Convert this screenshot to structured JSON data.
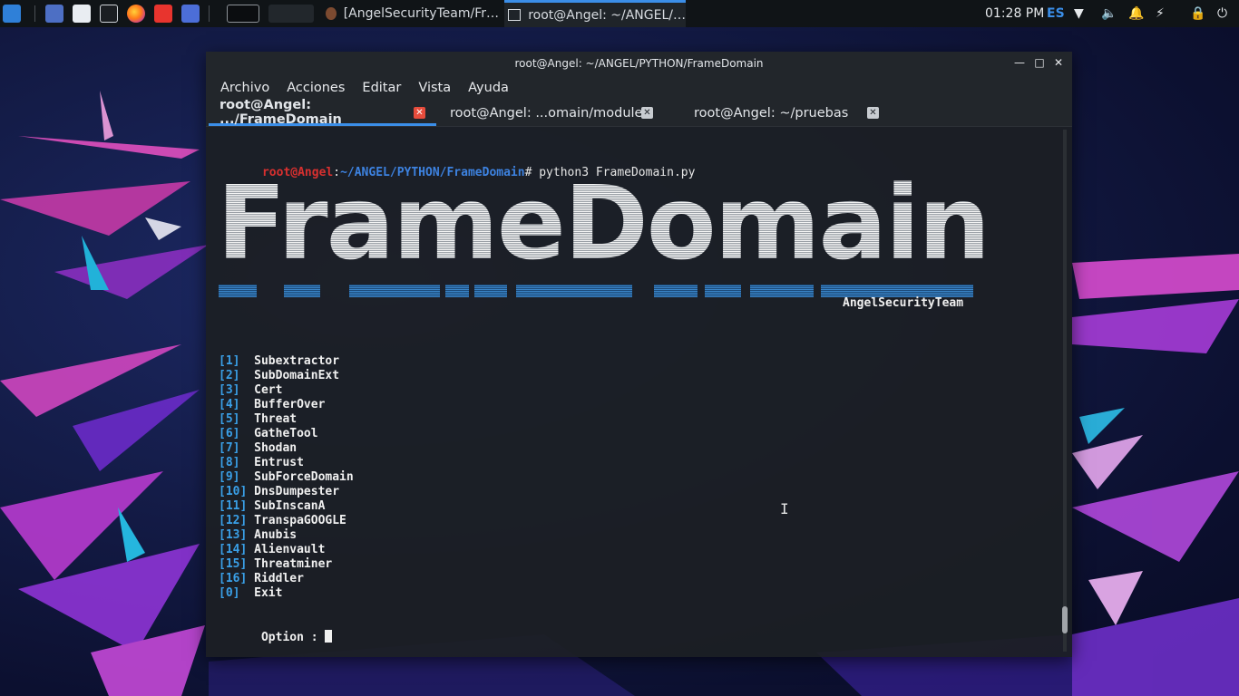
{
  "panel": {
    "clock": "01:28 PM",
    "language": "ES",
    "tasks": [
      {
        "label": "[AngelSecurityTeam/Fr…",
        "icon": "firefox-icon"
      },
      {
        "label": "root@Angel: ~/ANGEL/…",
        "icon": "terminal-icon"
      }
    ]
  },
  "window": {
    "title": "root@Angel: ~/ANGEL/PYTHON/FrameDomain",
    "menu": [
      "Archivo",
      "Acciones",
      "Editar",
      "Vista",
      "Ayuda"
    ],
    "tabs": [
      {
        "label": "root@Angel: .../FrameDomain"
      },
      {
        "label": "root@Angel: ...omain/module"
      },
      {
        "label": "root@Angel: ~/pruebas"
      }
    ]
  },
  "terminal": {
    "prompt_user": "root@Angel",
    "prompt_sep": ":",
    "prompt_path": "~/ANGEL/PYTHON/FrameDomain",
    "prompt_symbol": "#",
    "command": " python3 FrameDomain.py",
    "banner": "FrameDomain",
    "banner_credit": "AngelSecurityTeam",
    "options": [
      {
        "num": "[1] ",
        "label": "Subextractor"
      },
      {
        "num": "[2] ",
        "label": "SubDomainExt"
      },
      {
        "num": "[3] ",
        "label": "Cert"
      },
      {
        "num": "[4] ",
        "label": "BufferOver"
      },
      {
        "num": "[5] ",
        "label": "Threat"
      },
      {
        "num": "[6] ",
        "label": "GatheTool"
      },
      {
        "num": "[7] ",
        "label": "Shodan"
      },
      {
        "num": "[8] ",
        "label": "Entrust"
      },
      {
        "num": "[9] ",
        "label": "SubForceDomain"
      },
      {
        "num": "[10]",
        "label": "DnsDumpester"
      },
      {
        "num": "[11]",
        "label": "SubInscanA"
      },
      {
        "num": "[12]",
        "label": "TranspaGOOGLE"
      },
      {
        "num": "[13]",
        "label": "Anubis"
      },
      {
        "num": "[14]",
        "label": "Alienvault"
      },
      {
        "num": "[15]",
        "label": "Threatminer"
      },
      {
        "num": "[16]",
        "label": "Riddler"
      },
      {
        "num": "[0] ",
        "label": "Exit"
      }
    ],
    "input_prompt": "Option : "
  }
}
